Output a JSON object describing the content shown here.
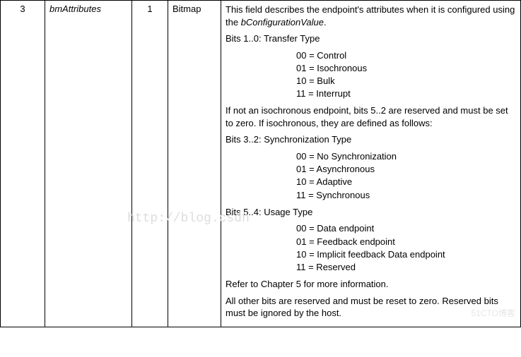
{
  "row": {
    "offset": "3",
    "field": "bmAttributes",
    "size": "1",
    "value": "Bitmap",
    "desc": {
      "intro_a": "This field describes the endpoint's attributes when it is configured using the ",
      "intro_b": "bConfigurationValue",
      "intro_c": ".",
      "bits10_title": "Bits 1..0:  Transfer Type",
      "bits10_items": [
        "00 = Control",
        "01 = Isochronous",
        "10 = Bulk",
        "11 = Interrupt"
      ],
      "iso_note": "If not an isochronous endpoint, bits 5..2 are reserved and must be set to zero. If isochronous, they are defined as follows:",
      "bits32_title": "Bits 3..2:  Synchronization Type",
      "bits32_items": [
        "00 = No Synchronization",
        "01 = Asynchronous",
        "10 = Adaptive",
        "11 = Synchronous"
      ],
      "bits54_title": "Bits 5..4:  Usage Type",
      "bits54_items": [
        "00 = Data endpoint",
        "01 = Feedback endpoint",
        "10 = Implicit feedback Data endpoint",
        "11 = Reserved"
      ],
      "refer": "Refer to Chapter 5 for more information.",
      "tail": "All other bits are reserved and must be reset to zero. Reserved bits must be ignored by the host."
    }
  },
  "watermark_left": "http://blog.csdn",
  "watermark_right": "51CTO博客"
}
